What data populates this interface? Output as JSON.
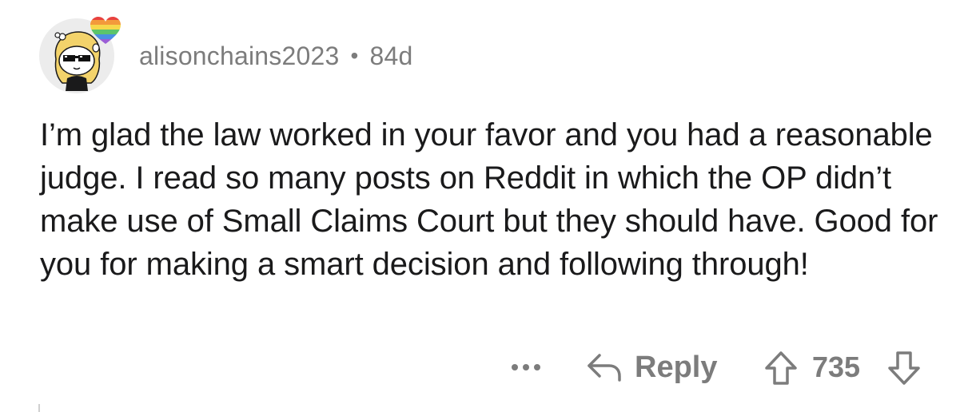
{
  "comment": {
    "username": "alisonchains2023",
    "separator": "•",
    "age": "84d",
    "body": "I’m glad the law worked in your favor and you had a reasonable judge. I read so many posts on Reddit in which the OP didn’t make use of Small Claims Court but they should have. Good for you for making a smart decision and following through!",
    "avatar_icon": "avatar-snoo-sunglasses-icon",
    "badge_icon": "rainbow-heart-icon"
  },
  "actions": {
    "more_icon": "more-dots-icon",
    "reply_label": "Reply",
    "reply_icon": "reply-arrow-icon",
    "upvote_icon": "upvote-arrow-icon",
    "vote_count": "735",
    "downvote_icon": "downvote-arrow-icon"
  },
  "colors": {
    "text": "#1a1a1b",
    "meta": "#7c7c7c",
    "background": "#ffffff"
  }
}
